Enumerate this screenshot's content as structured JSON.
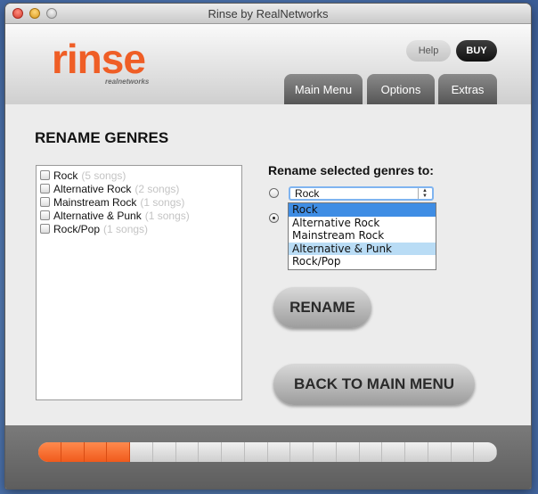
{
  "window": {
    "title": "Rinse by RealNetworks"
  },
  "header": {
    "logo_text": "rinse",
    "logo_subtext": "realnetworks",
    "help_label": "Help",
    "buy_label": "BUY",
    "tabs": [
      {
        "label": "Main Menu"
      },
      {
        "label": "Options"
      },
      {
        "label": "Extras"
      }
    ]
  },
  "main": {
    "heading": "RENAME GENRES",
    "genres": [
      {
        "name": "Rock",
        "count": "(5 songs)"
      },
      {
        "name": "Alternative Rock",
        "count": "(2 songs)"
      },
      {
        "name": "Mainstream Rock",
        "count": "(1 songs)"
      },
      {
        "name": "Alternative & Punk",
        "count": "(1 songs)"
      },
      {
        "name": "Rock/Pop",
        "count": "(1 songs)"
      }
    ],
    "rename_label": "Rename selected genres to:",
    "select_value": "Rock",
    "dropdown_options": [
      "Rock",
      "Alternative Rock",
      "Mainstream Rock",
      "Alternative & Punk",
      "Rock/Pop"
    ],
    "rename_button": "RENAME",
    "back_button": "BACK TO MAIN MENU"
  },
  "footer": {
    "progress_filled_segments": 4,
    "progress_total_segments": 20
  },
  "colors": {
    "brand_orange": "#ef5e26",
    "selection_blue": "#3f8de4",
    "hover_blue": "#b9dcf5"
  }
}
